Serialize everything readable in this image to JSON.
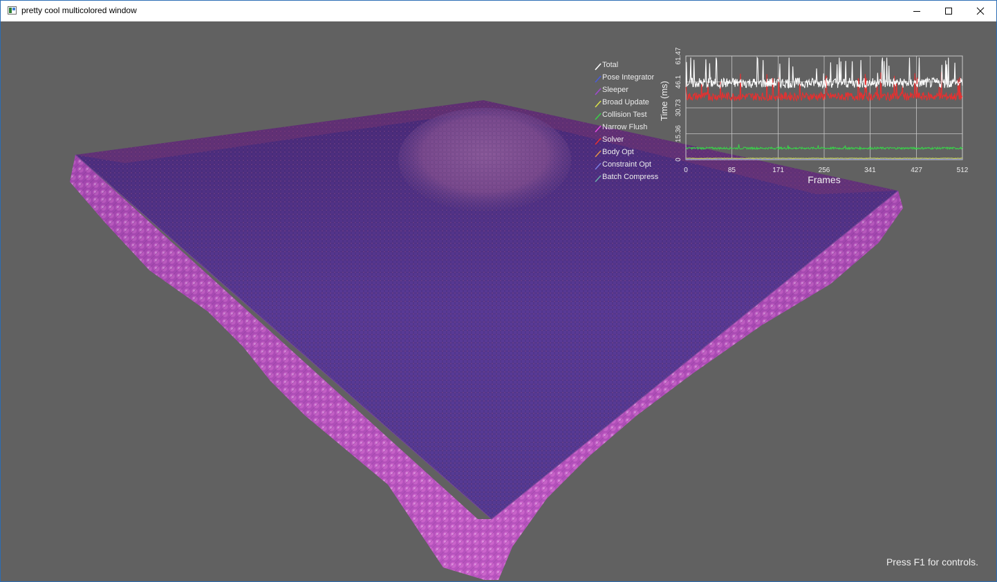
{
  "window": {
    "title": "pretty cool multicolored window",
    "icon": "app-window-icon",
    "controls": {
      "minimize": "minimize-icon",
      "maximize": "maximize-icon",
      "close": "close-icon"
    }
  },
  "legend": {
    "items": [
      {
        "label": "Total",
        "color": "#ffffff"
      },
      {
        "label": "Pose Integrator",
        "color": "#4a5bd8"
      },
      {
        "label": "Sleeper",
        "color": "#a04ad0"
      },
      {
        "label": "Broad Update",
        "color": "#d8e04a"
      },
      {
        "label": "Collision Test",
        "color": "#3ad14a"
      },
      {
        "label": "Narrow Flush",
        "color": "#e04ae0"
      },
      {
        "label": "Solver",
        "color": "#e83030"
      },
      {
        "label": "Body Opt",
        "color": "#e0904a"
      },
      {
        "label": "Constraint Opt",
        "color": "#7a7ae0"
      },
      {
        "label": "Batch Compress",
        "color": "#6aa8a8"
      }
    ]
  },
  "chart_data": {
    "type": "line",
    "xlabel": "Frames",
    "ylabel": "Time (ms)",
    "xlim": [
      0,
      512
    ],
    "ylim": [
      0,
      61.47
    ],
    "x_ticks": [
      "0",
      "85",
      "171",
      "256",
      "341",
      "427",
      "512"
    ],
    "y_ticks": [
      "0",
      "15.36",
      "30.73",
      "46.1",
      "61.47"
    ],
    "grid": true,
    "series": [
      {
        "name": "Total",
        "color": "#ffffff",
        "base": 45.5,
        "noise": 3.0,
        "spikes": 9
      },
      {
        "name": "Solver",
        "color": "#e83030",
        "base": 37.5,
        "noise": 2.5,
        "spikes": 7
      },
      {
        "name": "Collision Test",
        "color": "#3ad14a",
        "base": 6.8,
        "noise": 0.6,
        "spikes": 1
      },
      {
        "name": "Broad Update",
        "color": "#d8e04a",
        "base": 0.8,
        "noise": 0.15,
        "spikes": 0
      },
      {
        "name": "Pose Integrator",
        "color": "#4a5bd8",
        "base": 0.5,
        "noise": 0.1,
        "spikes": 0
      }
    ]
  },
  "hint": {
    "text": "Press F1 for controls."
  }
}
